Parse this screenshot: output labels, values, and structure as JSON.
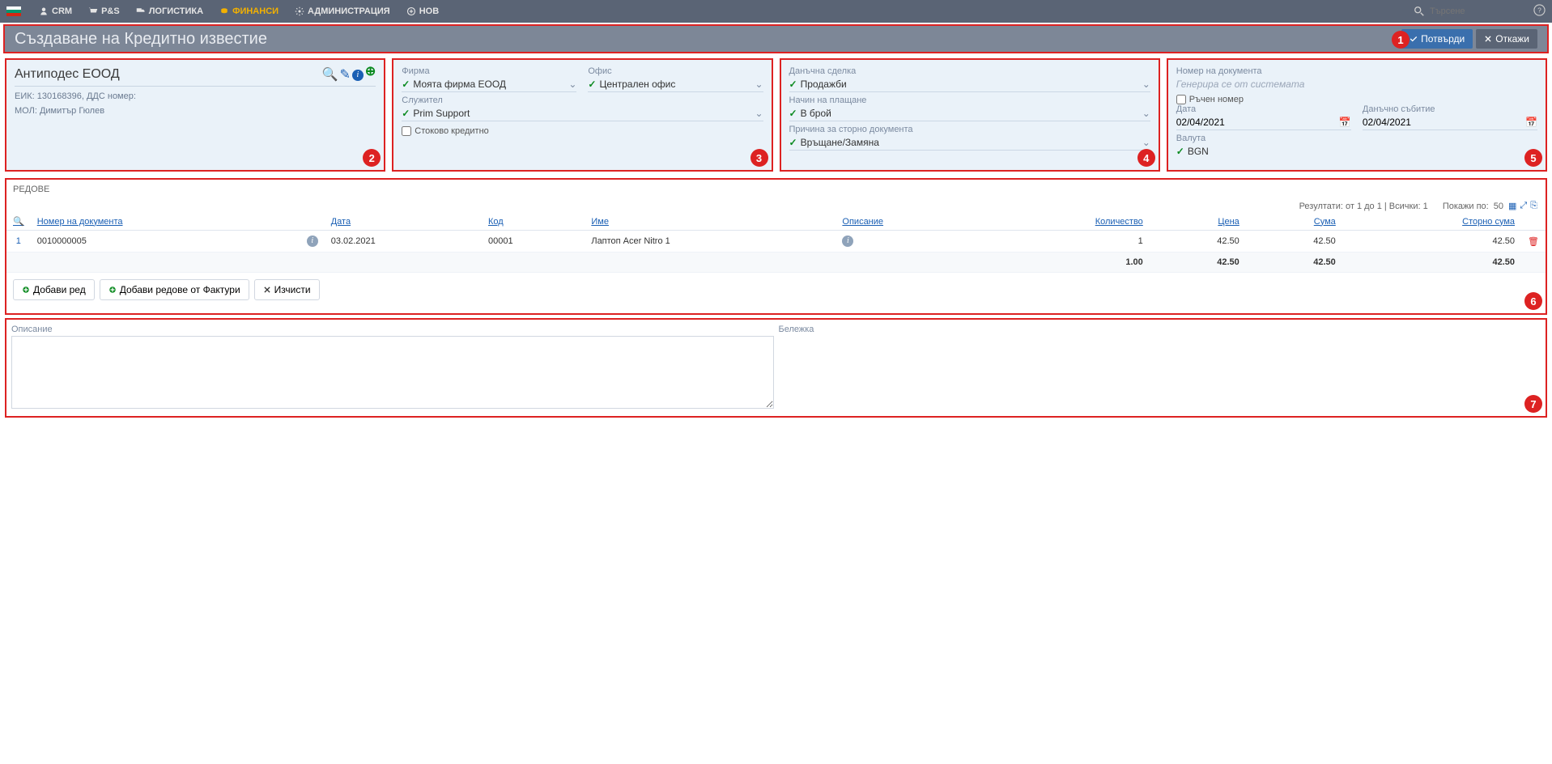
{
  "nav": {
    "items": [
      {
        "label": "CRM"
      },
      {
        "label": "P&S"
      },
      {
        "label": "ЛОГИСТИКА"
      },
      {
        "label": "ФИНАНСИ",
        "active": true
      },
      {
        "label": "АДМИНИСТРАЦИЯ"
      },
      {
        "label": "НОВ"
      }
    ],
    "search_placeholder": "Търсене"
  },
  "header": {
    "title": "Създаване на Кредитно известие",
    "confirm": "Потвърди",
    "cancel": "Откажи",
    "annot": "1"
  },
  "client": {
    "name": "Антиподес ЕООД",
    "eik_label": "ЕИК:",
    "eik": "130168396",
    "vat_label": "ДДС номер:",
    "mol_label": "МОЛ:",
    "mol": "Димитър Гюлев",
    "annot": "2"
  },
  "firm": {
    "firm_label": "Фирма",
    "firm_value": "Моята фирма ЕООД",
    "office_label": "Офис",
    "office_value": "Централен офис",
    "employee_label": "Служител",
    "employee_value": "Prim Support",
    "stock_credit": "Стоково кредитно",
    "annot": "3"
  },
  "deal": {
    "tax_deal_label": "Данъчна сделка",
    "tax_deal_value": "Продажби",
    "payment_label": "Начин на плащане",
    "payment_value": "В брой",
    "reason_label": "Причина за сторно документа",
    "reason_value": "Връщане/Замяна",
    "annot": "4"
  },
  "doc": {
    "num_label": "Номер на документа",
    "num_placeholder": "Генерира се от системата",
    "manual_label": "Ръчен номер",
    "date_label": "Дата",
    "date_value": "02/04/2021",
    "tax_event_label": "Данъчно събитие",
    "tax_event_value": "02/04/2021",
    "currency_label": "Валута",
    "currency_value": "BGN",
    "annot": "5"
  },
  "rows": {
    "title": "РЕДОВЕ",
    "results": "Резултати: от 1 до 1 | Всички: 1",
    "showby": "Покажи по:",
    "showby_value": "50",
    "headers": {
      "docnum": "Номер на документа",
      "date": "Дата",
      "code": "Код",
      "name": "Име",
      "desc": "Описание",
      "qty": "Количество",
      "price": "Цена",
      "sum": "Сума",
      "storno": "Сторно сума"
    },
    "items": [
      {
        "idx": "1",
        "docnum": "0010000005",
        "date": "03.02.2021",
        "code": "00001",
        "name": "Лаптоп Acer Nitro 1",
        "desc": "",
        "qty": "1",
        "price": "42.50",
        "sum": "42.50",
        "storno": "42.50"
      }
    ],
    "totals": {
      "qty": "1.00",
      "price": "42.50",
      "sum": "42.50",
      "storno": "42.50"
    },
    "add_row": "Добави ред",
    "add_from_inv": "Добави редове от Фактури",
    "clear": "Изчисти",
    "annot": "6"
  },
  "notes": {
    "desc_label": "Описание",
    "note_label": "Бележка",
    "annot": "7"
  }
}
